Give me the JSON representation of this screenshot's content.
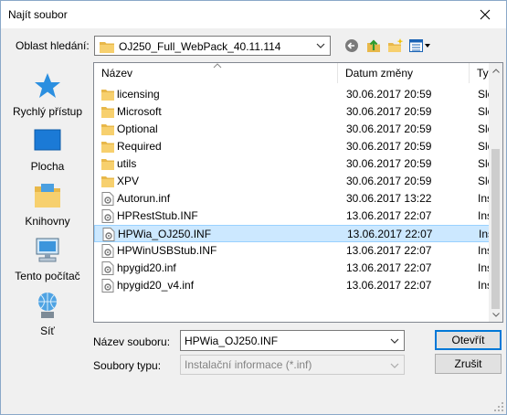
{
  "window": {
    "title": "Najít soubor"
  },
  "lookin": {
    "label": "Oblast hledání:",
    "value": "OJ250_Full_WebPack_40.11.114"
  },
  "toolbar": {
    "back_icon": "back-arrow-icon",
    "up_icon": "up-folder-icon",
    "new_folder_icon": "new-folder-icon",
    "view_icon": "view-menu-icon"
  },
  "places": [
    {
      "label": "Rychlý přístup",
      "icon": "star-icon"
    },
    {
      "label": "Plocha",
      "icon": "desktop-icon"
    },
    {
      "label": "Knihovny",
      "icon": "libraries-icon"
    },
    {
      "label": "Tento počítač",
      "icon": "computer-icon"
    },
    {
      "label": "Síť",
      "icon": "network-icon"
    }
  ],
  "columns": {
    "name": "Název",
    "date": "Datum změny",
    "type": "Ty"
  },
  "files": [
    {
      "name": "licensing",
      "date": "30.06.2017 20:59",
      "type": "Slo",
      "kind": "folder"
    },
    {
      "name": "Microsoft",
      "date": "30.06.2017 20:59",
      "type": "Slo",
      "kind": "folder"
    },
    {
      "name": "Optional",
      "date": "30.06.2017 20:59",
      "type": "Slo",
      "kind": "folder"
    },
    {
      "name": "Required",
      "date": "30.06.2017 20:59",
      "type": "Slo",
      "kind": "folder"
    },
    {
      "name": "utils",
      "date": "30.06.2017 20:59",
      "type": "Slo",
      "kind": "folder"
    },
    {
      "name": "XPV",
      "date": "30.06.2017 20:59",
      "type": "Slo",
      "kind": "folder"
    },
    {
      "name": "Autorun.inf",
      "date": "30.06.2017 13:22",
      "type": "Ins",
      "kind": "inf"
    },
    {
      "name": "HPRestStub.INF",
      "date": "13.06.2017 22:07",
      "type": "Ins",
      "kind": "inf"
    },
    {
      "name": "HPWia_OJ250.INF",
      "date": "13.06.2017 22:07",
      "type": "Ins",
      "kind": "inf",
      "selected": true
    },
    {
      "name": "HPWinUSBStub.INF",
      "date": "13.06.2017 22:07",
      "type": "Ins",
      "kind": "inf"
    },
    {
      "name": "hpygid20.inf",
      "date": "13.06.2017 22:07",
      "type": "Ins",
      "kind": "inf"
    },
    {
      "name": "hpygid20_v4.inf",
      "date": "13.06.2017 22:07",
      "type": "Ins",
      "kind": "inf"
    }
  ],
  "filename": {
    "label": "Název souboru:",
    "value": "HPWia_OJ250.INF"
  },
  "filetype": {
    "label": "Soubory typu:",
    "value": "Instalační informace (*.inf)"
  },
  "buttons": {
    "open": "Otevřít",
    "cancel": "Zrušit"
  },
  "colors": {
    "selection": "#cce8ff",
    "accent": "#0078d7",
    "folder": "#e8b84a"
  }
}
